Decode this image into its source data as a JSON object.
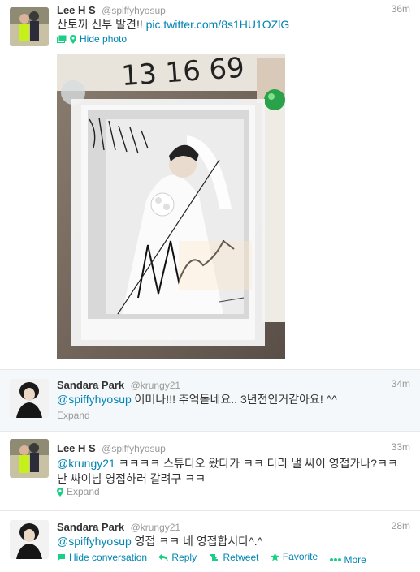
{
  "tweets": [
    {
      "fullname": "Lee H S",
      "username": "@spiffyhyosup",
      "time": "36m",
      "text_main": "산토끼 신부 발견!! ",
      "text_link": "pic.twitter.com/8s1HU1OZlG",
      "actions": {
        "hide_photo": "Hide photo"
      }
    },
    {
      "fullname": "Sandara Park",
      "username": "@krungy21",
      "time": "34m",
      "mention": "@spiffyhyosup",
      "text_main": " 어머나!!! 추억돋네요.. 3년전인거같아요! ^^",
      "actions": {
        "expand": "Expand"
      }
    },
    {
      "fullname": "Lee H S",
      "username": "@spiffyhyosup",
      "time": "33m",
      "mention": "@krungy21",
      "text_main": " ㅋㅋㅋㅋ 스튜디오 왔다가 ㅋㅋ 다라 낼 싸이 영접가나?ㅋㅋ 난 싸이님 영접하러 갈려구 ㅋㅋ",
      "actions": {
        "expand": "Expand"
      }
    },
    {
      "fullname": "Sandara Park",
      "username": "@krungy21",
      "time": "28m",
      "mention": "@spiffyhyosup",
      "text_main": " 영접 ㅋㅋ 네 영접합시다^.^",
      "actions": {
        "hide_conversation": "Hide conversation",
        "reply": "Reply",
        "retweet": "Retweet",
        "favorite": "Favorite",
        "more": "More"
      }
    }
  ],
  "colors": {
    "link": "#0084b4",
    "muted": "#999999",
    "expanded_bg": "#f5f8fa",
    "action_green": "#19cf86"
  },
  "icons": [
    "media-icon",
    "location-pin-icon",
    "reply-icon",
    "retweet-icon",
    "favorite-star-icon",
    "more-dots-icon"
  ]
}
